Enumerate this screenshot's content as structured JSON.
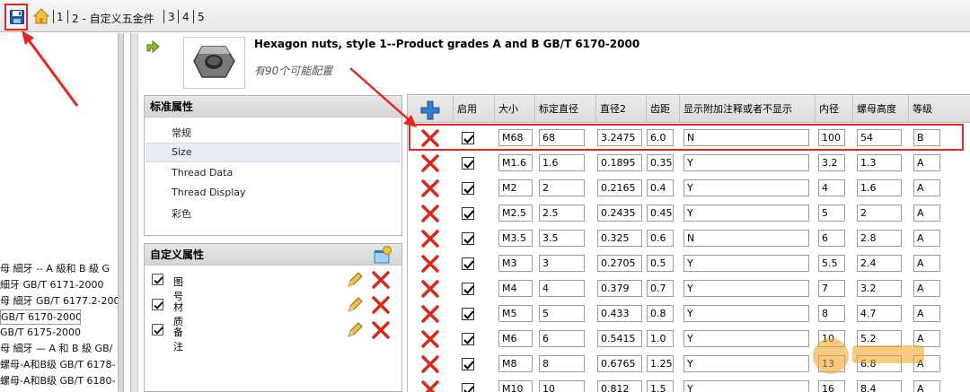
{
  "toolbar": {
    "crumbs": [
      "1",
      "2 - 自定义五金件",
      "3",
      "4",
      "5"
    ]
  },
  "left_tree": [
    "母 細牙 -- A 級和 B 級 G",
    "細牙 GB/T 6171-2000",
    "母 細牙 GB/T 6177.2-200",
    "GB/T 6170-2000",
    "GB/T 6175-2000",
    "母 細牙 — A 和 B 級 GB/",
    "螺母-A和B级 GB/T 6178-",
    "螺母-A和B级 GB/T 6180-"
  ],
  "part": {
    "title": "Hexagon nuts, style 1--Product grades A and B GB/T 6170-2000",
    "subtitle": "有90个可能配置"
  },
  "standard_props": {
    "header": "标准属性",
    "items": [
      "常规",
      "Size",
      "Thread Data",
      "Thread Display",
      "彩色"
    ],
    "selected_index": 1
  },
  "custom_props": {
    "header": "自定义属性",
    "items": [
      "图号",
      "材质",
      "备注"
    ]
  },
  "grid": {
    "columns": [
      "启用",
      "大小",
      "标定直径",
      "直径2",
      "齿距",
      "显示附加注释或者不显示",
      "内径",
      "螺母高度",
      "等级"
    ],
    "rows": [
      [
        "M68",
        "68",
        "3.2475",
        "6.0",
        "N",
        "100",
        "54",
        "B"
      ],
      [
        "M1.6",
        "1.6",
        "0.1895",
        "0.35",
        "Y",
        "3.2",
        "1.3",
        "A"
      ],
      [
        "M2",
        "2",
        "0.2165",
        "0.4",
        "Y",
        "4",
        "1.6",
        "A"
      ],
      [
        "M2.5",
        "2.5",
        "0.2435",
        "0.45",
        "Y",
        "5",
        "2",
        "A"
      ],
      [
        "M3.5",
        "3.5",
        "0.325",
        "0.6",
        "N",
        "6",
        "2.8",
        "A"
      ],
      [
        "M3",
        "3",
        "0.2705",
        "0.5",
        "Y",
        "5.5",
        "2.4",
        "A"
      ],
      [
        "M4",
        "4",
        "0.379",
        "0.7",
        "Y",
        "7",
        "3.2",
        "A"
      ],
      [
        "M5",
        "5",
        "0.433",
        "0.8",
        "Y",
        "8",
        "4.7",
        "A"
      ],
      [
        "M6",
        "6",
        "0.5415",
        "1.0",
        "Y",
        "10",
        "5.2",
        "A"
      ],
      [
        "M8",
        "8",
        "0.6765",
        "1.25",
        "Y",
        "13",
        "6.8",
        "A"
      ],
      [
        "M10",
        "10",
        "0.812",
        "1.5",
        "Y",
        "16",
        "8.4",
        "A"
      ]
    ]
  },
  "colors": {
    "annotation_red": "#e8261f",
    "delete_red": "#d42a1c",
    "add_blue": "#2f7fd3"
  },
  "icons": {
    "save": "save-icon",
    "home": "home-icon",
    "add": "add-row-icon",
    "delete": "delete-x-icon",
    "edit": "pencil-icon"
  }
}
